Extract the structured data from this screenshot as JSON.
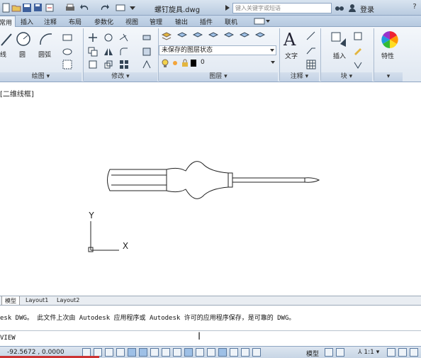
{
  "titlebar": {
    "title": "螺钉旋具.dwg",
    "search_placeholder": "键入关键字或短语",
    "login_label": "登录"
  },
  "tabs": [
    {
      "label": "常用",
      "active": true
    },
    {
      "label": "插入"
    },
    {
      "label": "注释"
    },
    {
      "label": "布局"
    },
    {
      "label": "参数化"
    },
    {
      "label": "视图"
    },
    {
      "label": "管理"
    },
    {
      "label": "输出"
    },
    {
      "label": "插件"
    },
    {
      "label": "联机"
    }
  ],
  "ribbon": {
    "draw_tools": {
      "line": "线",
      "circle": "圆",
      "arc": "圆弧"
    },
    "annotation_tools": {
      "text": "文字"
    },
    "block_tools": {
      "insert": "插入"
    },
    "properties_tools": {
      "properties": "特性"
    },
    "layer_state": "未保存的图层状态",
    "layer_current": "0",
    "panels": {
      "draw": "绘图",
      "modify": "修改",
      "layers": "图层",
      "annotation": "注释",
      "block": "块"
    }
  },
  "drawing": {
    "view_label": "[二维线框]",
    "ucs": {
      "x_label": "X",
      "y_label": "Y"
    }
  },
  "layout_tabs": [
    {
      "label": "模型",
      "active": true
    },
    {
      "label": "Layout1"
    },
    {
      "label": "Layout2"
    }
  ],
  "command": {
    "history": "esk DWG。  此文件上次由 Autodesk 应用程序或 Autodesk 许可的应用程序保存，是可靠的 DWG。",
    "current": "VIEW"
  },
  "status": {
    "coordinates": "-92.5672 , 0.0000",
    "model_label": "模型",
    "scale": "1:1"
  }
}
